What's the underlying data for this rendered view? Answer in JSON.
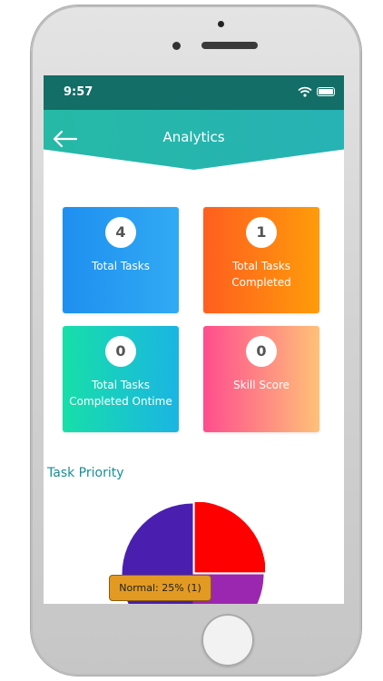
{
  "status_bar": {
    "time": "9:57"
  },
  "app_bar": {
    "title": "Analytics"
  },
  "cards": [
    {
      "value": "4",
      "label": "Total Tasks"
    },
    {
      "value": "1",
      "label": "Total Tasks Completed"
    },
    {
      "value": "0",
      "label": "Total Tasks Completed Ontime"
    },
    {
      "value": "0",
      "label": "Skill Score"
    }
  ],
  "section": {
    "title": "Task Priority"
  },
  "chart_data": {
    "type": "pie",
    "slices": [
      {
        "value": 25,
        "color": "#ff0000"
      },
      {
        "value": 25,
        "color": "#9b27b0"
      },
      {
        "value": 50,
        "color": "#4a1fb0"
      }
    ],
    "tooltip": "Normal: 25% (1)"
  },
  "colors": {
    "status_bar": "#126e66",
    "app_bar": "#26b9a6",
    "section_title": "#178f96"
  }
}
